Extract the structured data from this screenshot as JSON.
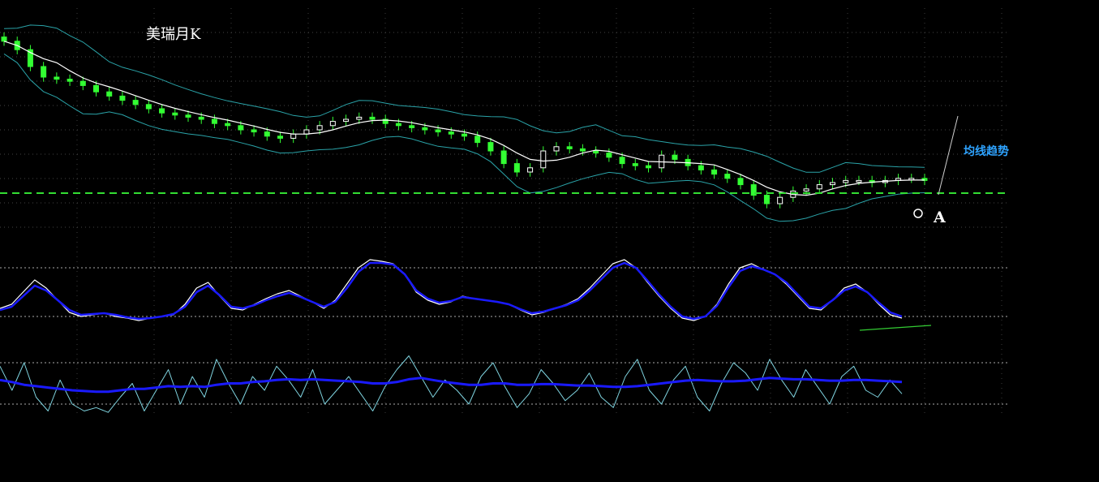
{
  "title": "美瑞月K",
  "annotations": {
    "trend_label": "均线趋势",
    "point_label": "A"
  },
  "colors": {
    "background": "#000000",
    "candle_up_outline": "#ffffff",
    "candle_body": "#33ff33",
    "moving_average": "#ffffff",
    "band": "#2aa3a8",
    "support_line": "#33dd33",
    "grid": "#555555",
    "osc_fast": "#ffffff",
    "osc_slow": "#1a1aff",
    "osc2_thin": "#7fd4e0",
    "osc2_thick": "#1a1aff",
    "divergence_line": "#33cc33",
    "trend_stroke": "#d0d0d0"
  },
  "chart_data": [
    {
      "type": "candlestick",
      "name": "price",
      "title": "美瑞月K",
      "ylim": [
        0,
        100
      ],
      "grid": true,
      "close": [
        92,
        88,
        80,
        75,
        74,
        73,
        71,
        68,
        66,
        64,
        62,
        60,
        58,
        57,
        56,
        55,
        53,
        52,
        50,
        49,
        47,
        46,
        48,
        50,
        52,
        54,
        55,
        56,
        55,
        53,
        52,
        51,
        50,
        49,
        48,
        47,
        44,
        40,
        34,
        30,
        32,
        40,
        42,
        41,
        40,
        39,
        37,
        34,
        33,
        32,
        38,
        36,
        33,
        31,
        29,
        27,
        24,
        19,
        15,
        18,
        21,
        22,
        24,
        25,
        26,
        26,
        25,
        26,
        27,
        27,
        26
      ],
      "support_level": 20,
      "support_style": "dashed"
    },
    {
      "type": "line",
      "name": "oscillator-1",
      "ylim": [
        0,
        100
      ],
      "levels": [
        80,
        20
      ],
      "series": [
        {
          "values": [
            30,
            35,
            50,
            65,
            55,
            40,
            25,
            20,
            22,
            24,
            20,
            18,
            15,
            18,
            20,
            22,
            35,
            55,
            62,
            45,
            30,
            28,
            35,
            42,
            48,
            52,
            45,
            38,
            30,
            40,
            60,
            80,
            90,
            88,
            85,
            72,
            50,
            40,
            35,
            38,
            45,
            42,
            40,
            38,
            35,
            28,
            22,
            25,
            30,
            35,
            42,
            55,
            70,
            85,
            90,
            80,
            62,
            45,
            30,
            18,
            15,
            20,
            35,
            60,
            80,
            85,
            78,
            72,
            60,
            45,
            30,
            28,
            40,
            55,
            60,
            50,
            35,
            22,
            18
          ]
        },
        {
          "values": [
            28,
            32,
            45,
            58,
            52,
            40,
            28,
            22,
            23,
            24,
            22,
            19,
            17,
            18,
            20,
            23,
            32,
            50,
            58,
            46,
            32,
            30,
            34,
            40,
            45,
            49,
            44,
            38,
            32,
            38,
            55,
            75,
            86,
            86,
            84,
            72,
            52,
            42,
            37,
            39,
            44,
            42,
            40,
            38,
            35,
            29,
            24,
            26,
            30,
            34,
            40,
            52,
            66,
            80,
            86,
            80,
            64,
            47,
            32,
            20,
            17,
            20,
            33,
            56,
            76,
            82,
            78,
            72,
            62,
            47,
            32,
            30,
            40,
            52,
            57,
            50,
            37,
            25,
            20
          ]
        }
      ],
      "divergence": [
        22,
        28
      ]
    },
    {
      "type": "line",
      "name": "oscillator-2",
      "ylim": [
        0,
        100
      ],
      "levels": [
        80,
        20
      ],
      "series": [
        {
          "values": [
            75,
            40,
            80,
            30,
            10,
            55,
            20,
            10,
            15,
            8,
            30,
            50,
            10,
            40,
            70,
            20,
            60,
            30,
            85,
            50,
            20,
            60,
            40,
            75,
            55,
            30,
            70,
            20,
            40,
            60,
            35,
            10,
            45,
            70,
            90,
            60,
            30,
            55,
            40,
            20,
            60,
            80,
            45,
            15,
            35,
            70,
            50,
            25,
            40,
            65,
            30,
            15,
            60,
            85,
            40,
            20,
            55,
            75,
            30,
            10,
            50,
            80,
            65,
            40,
            85,
            55,
            30,
            70,
            45,
            20,
            60,
            75,
            40,
            30,
            55,
            35
          ]
        },
        {
          "values": [
            55,
            52,
            48,
            46,
            44,
            42,
            40,
            39,
            38,
            38,
            40,
            42,
            42,
            44,
            46,
            45,
            46,
            45,
            48,
            50,
            50,
            52,
            53,
            55,
            56,
            55,
            56,
            55,
            54,
            53,
            52,
            50,
            50,
            52,
            56,
            58,
            55,
            52,
            50,
            48,
            48,
            50,
            50,
            48,
            48,
            49,
            49,
            48,
            47,
            47,
            46,
            45,
            45,
            46,
            48,
            50,
            52,
            54,
            55,
            54,
            53,
            53,
            54,
            56,
            58,
            57,
            56,
            56,
            55,
            54,
            54,
            55,
            55,
            54,
            53,
            52
          ]
        }
      ]
    }
  ]
}
